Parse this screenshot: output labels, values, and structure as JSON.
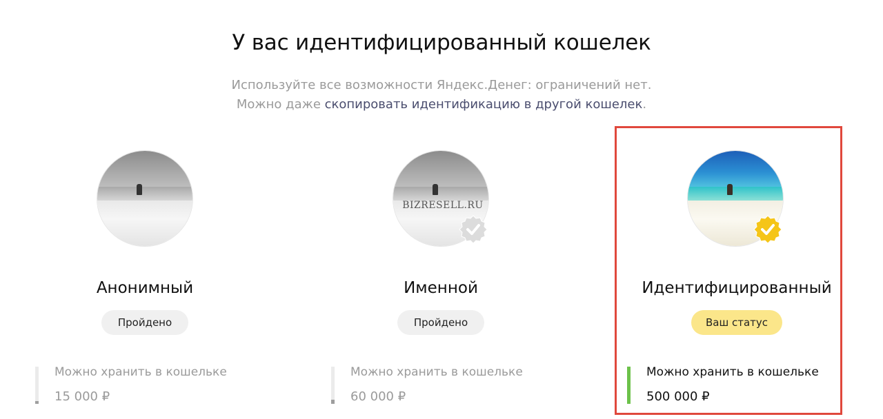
{
  "header": {
    "title": "У вас идентифицированный кошелек",
    "line1": "Используйте все возможности Яндекс.Денег: ограничений нет.",
    "line2_prefix": "Можно даже ",
    "line2_link": "скопировать идентификацию в другой кошелек",
    "line2_suffix": "."
  },
  "watermark": "BIZRESELL.RU",
  "colors": {
    "highlight_border": "#e0483c",
    "current_pill": "#fbe68a",
    "done_pill": "#f0f0f0",
    "bar_gray": "#9e9e9e",
    "bar_green": "#6cc24a",
    "badge_gold": "#f5c518",
    "badge_gray": "#dcdcdc"
  },
  "statuses": [
    {
      "name": "Анонимный",
      "pill": "Пройдено",
      "limit_label": "Можно хранить в кошельке",
      "limit_value": "15 000 ₽",
      "fill_fraction": 0.03,
      "badge": "none"
    },
    {
      "name": "Именной",
      "pill": "Пройдено",
      "limit_label": "Можно хранить в кошельке",
      "limit_value": "60 000 ₽",
      "fill_fraction": 0.12,
      "badge": "checkmark-gray-icon"
    },
    {
      "name": "Идентифицированный",
      "pill": "Ваш статус",
      "limit_label": "Можно хранить в кошельке",
      "limit_value": "500 000 ₽",
      "fill_fraction": 1.0,
      "badge": "checkmark-gold-icon"
    }
  ]
}
